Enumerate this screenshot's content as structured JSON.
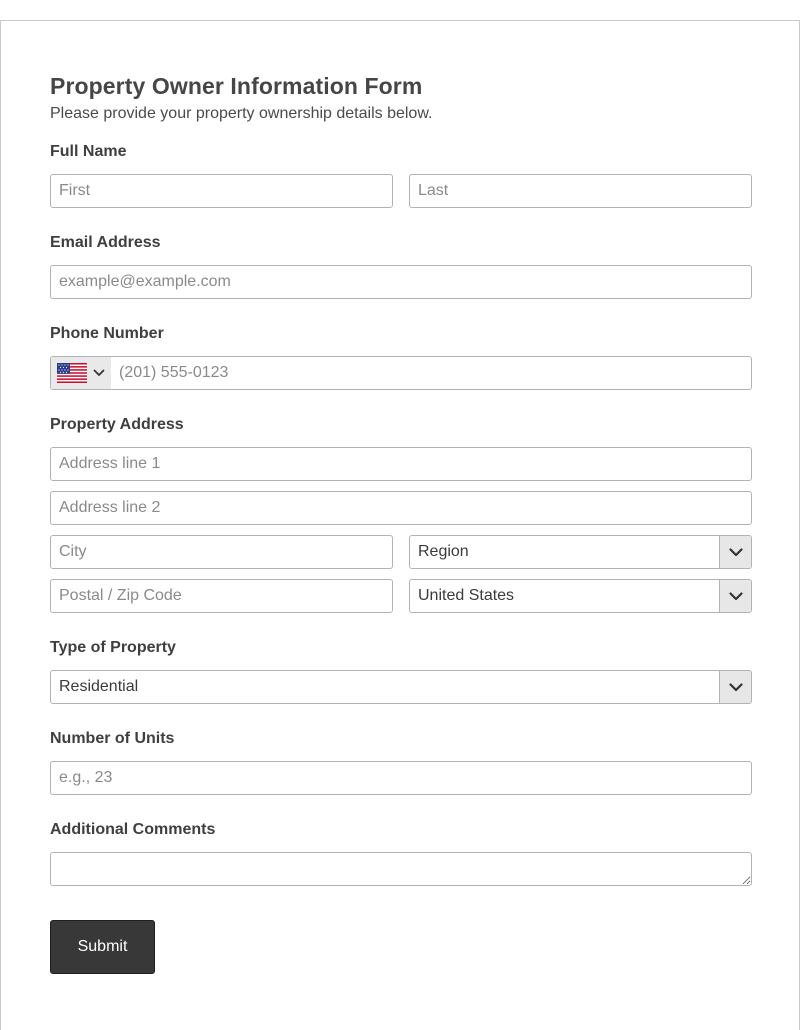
{
  "form": {
    "title": "Property Owner Information Form",
    "subtitle": "Please provide your property ownership details below."
  },
  "full_name": {
    "label": "Full Name",
    "first_placeholder": "First",
    "last_placeholder": "Last"
  },
  "email": {
    "label": "Email Address",
    "placeholder": "example@example.com"
  },
  "phone": {
    "label": "Phone Number",
    "country_icon": "us-flag-icon",
    "placeholder": "(201) 555-0123"
  },
  "address": {
    "label": "Property Address",
    "line1_placeholder": "Address line 1",
    "line2_placeholder": "Address line 2",
    "city_placeholder": "City",
    "region_value": "Region",
    "postal_placeholder": "Postal / Zip Code",
    "country_value": "United States"
  },
  "property_type": {
    "label": "Type of Property",
    "value": "Residential"
  },
  "units": {
    "label": "Number of Units",
    "placeholder": "e.g., 23"
  },
  "comments": {
    "label": "Additional Comments"
  },
  "submit": {
    "label": "Submit"
  },
  "colors": {
    "button_bg": "#383838",
    "border": "#b3b3b3",
    "select_arrow_bg": "#e7e7e7"
  }
}
